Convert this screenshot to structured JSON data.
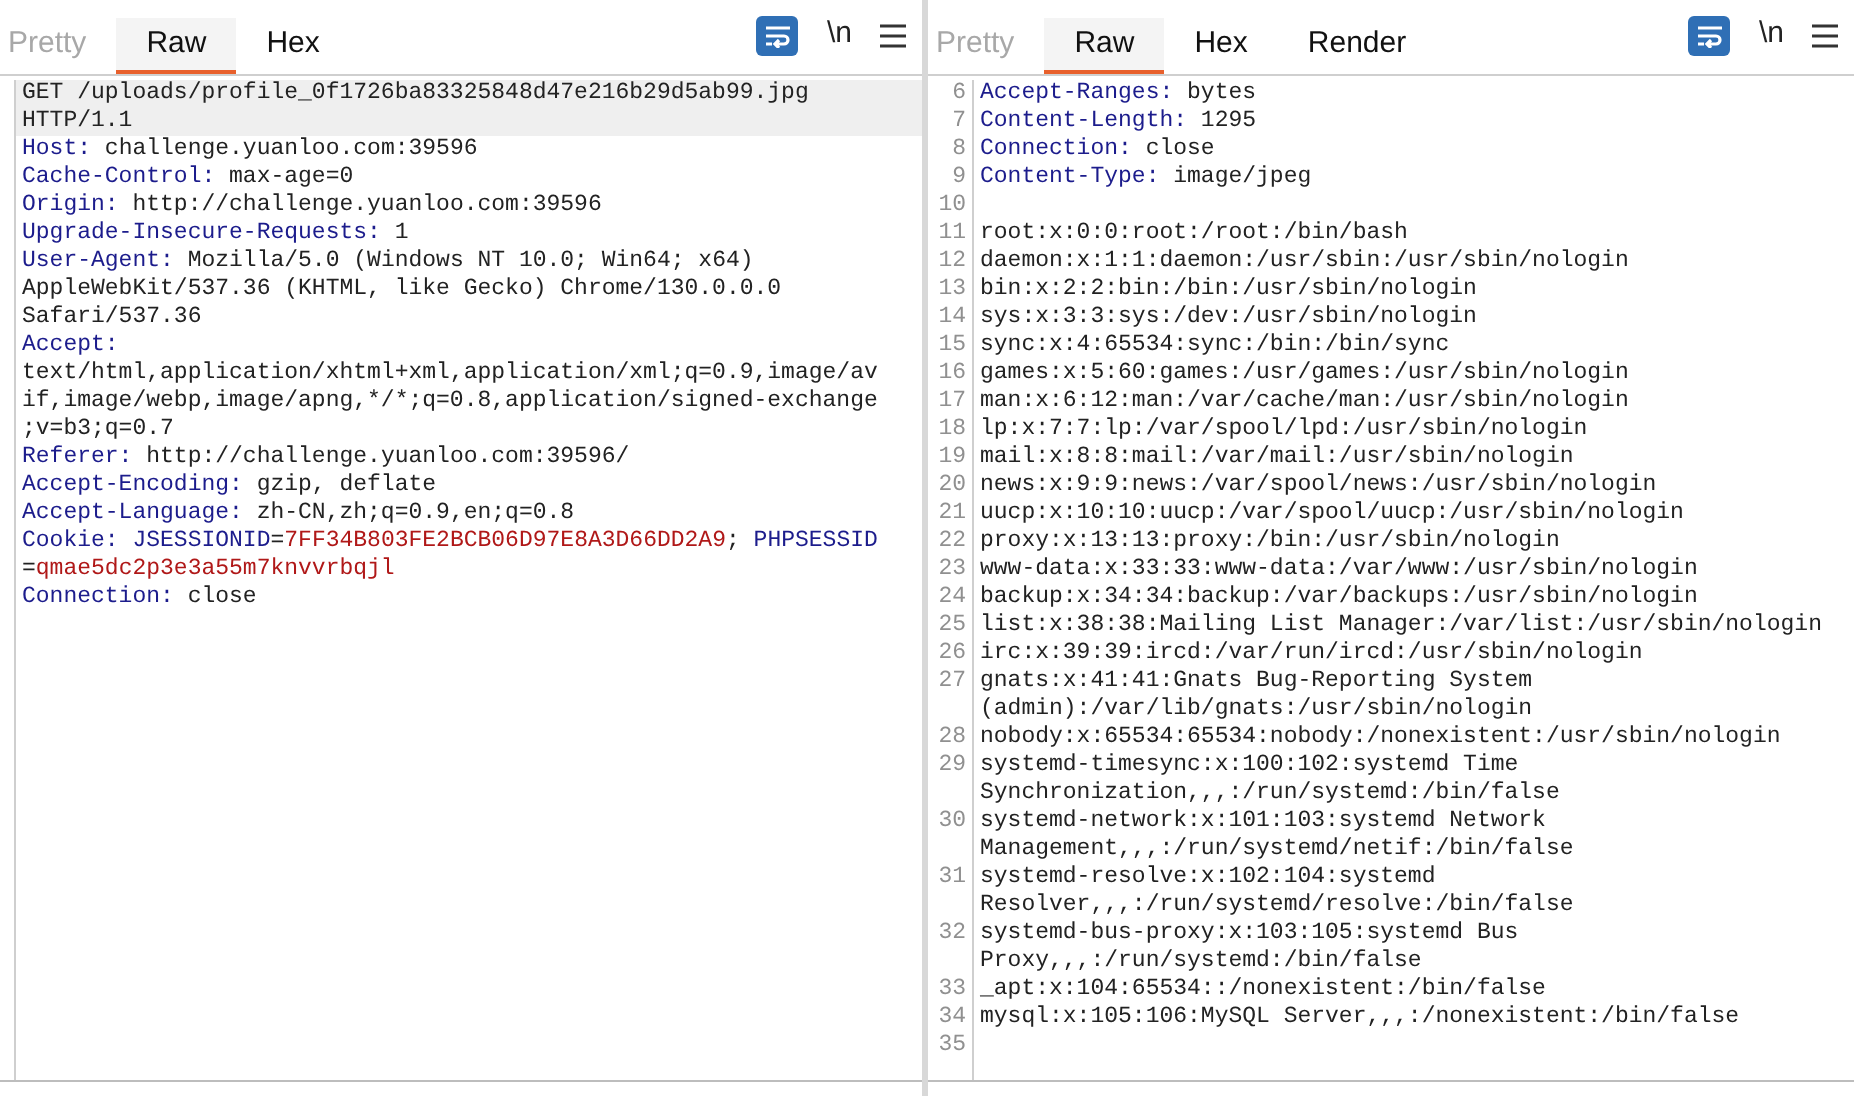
{
  "panels": [
    {
      "tabs": [
        {
          "label": "Pretty",
          "selected": false,
          "disabled": true
        },
        {
          "label": "Raw",
          "selected": true,
          "disabled": false
        },
        {
          "label": "Hex",
          "selected": false,
          "disabled": false
        }
      ],
      "toolbar": {
        "wrap_on": true,
        "newline_label": "\\n"
      },
      "lines": [
        {
          "rows": [
            [
              {
                "kind": "plain",
                "text": "GET /uploads/profile_0f1726ba83325848d47e216b29d5ab99.jpg"
              }
            ],
            [
              {
                "kind": "plain",
                "text": "HTTP/1.1"
              }
            ]
          ],
          "highlighted": true
        },
        {
          "rows": [
            [
              {
                "kind": "key",
                "text": "Host:"
              },
              {
                "kind": "plain",
                "text": " challenge.yuanloo.com:39596"
              }
            ]
          ],
          "highlighted": false
        },
        {
          "rows": [
            [
              {
                "kind": "key",
                "text": "Cache-Control:"
              },
              {
                "kind": "plain",
                "text": " max-age=0"
              }
            ]
          ],
          "highlighted": false
        },
        {
          "rows": [
            [
              {
                "kind": "key",
                "text": "Origin:"
              },
              {
                "kind": "plain",
                "text": " http://challenge.yuanloo.com:39596"
              }
            ]
          ],
          "highlighted": false
        },
        {
          "rows": [
            [
              {
                "kind": "key",
                "text": "Upgrade-Insecure-Requests:"
              },
              {
                "kind": "plain",
                "text": " 1"
              }
            ]
          ],
          "highlighted": false
        },
        {
          "rows": [
            [
              {
                "kind": "key",
                "text": "User-Agent:"
              },
              {
                "kind": "plain",
                "text": " Mozilla/5.0 (Windows NT 10.0; Win64; x64)"
              }
            ],
            [
              {
                "kind": "plain",
                "text": "AppleWebKit/537.36 (KHTML, like Gecko) Chrome/130.0.0.0"
              }
            ],
            [
              {
                "kind": "plain",
                "text": "Safari/537.36"
              }
            ]
          ],
          "highlighted": false
        },
        {
          "rows": [
            [
              {
                "kind": "key",
                "text": "Accept:"
              }
            ],
            [
              {
                "kind": "plain",
                "text": "text/html,application/xhtml+xml,application/xml;q=0.9,image/av"
              }
            ],
            [
              {
                "kind": "plain",
                "text": "if,image/webp,image/apng,*/*;q=0.8,application/signed-exchange"
              }
            ],
            [
              {
                "kind": "plain",
                "text": ";v=b3;q=0.7"
              }
            ]
          ],
          "highlighted": false
        },
        {
          "rows": [
            [
              {
                "kind": "key",
                "text": "Referer:"
              },
              {
                "kind": "plain",
                "text": " http://challenge.yuanloo.com:39596/"
              }
            ]
          ],
          "highlighted": false
        },
        {
          "rows": [
            [
              {
                "kind": "key",
                "text": "Accept-Encoding:"
              },
              {
                "kind": "plain",
                "text": " gzip, deflate"
              }
            ]
          ],
          "highlighted": false
        },
        {
          "rows": [
            [
              {
                "kind": "key",
                "text": "Accept-Language:"
              },
              {
                "kind": "plain",
                "text": " zh-CN,zh;q=0.9,en;q=0.8"
              }
            ]
          ],
          "highlighted": false
        },
        {
          "rows": [
            [
              {
                "kind": "key",
                "text": "Cookie:"
              },
              {
                "kind": "plain",
                "text": " "
              },
              {
                "kind": "key",
                "text": "JSESSIONID"
              },
              {
                "kind": "plain",
                "text": "="
              },
              {
                "kind": "value",
                "text": "7FF34B803FE2BCB06D97E8A3D66DD2A9"
              },
              {
                "kind": "plain",
                "text": "; "
              },
              {
                "kind": "key",
                "text": "PHPSESSID"
              }
            ],
            [
              {
                "kind": "plain",
                "text": "="
              },
              {
                "kind": "value",
                "text": "qmae5dc2p3e3a55m7knvvrbqjl"
              }
            ]
          ],
          "highlighted": false
        },
        {
          "rows": [
            [
              {
                "kind": "key",
                "text": "Connection:"
              },
              {
                "kind": "plain",
                "text": " close"
              }
            ]
          ],
          "highlighted": false
        }
      ]
    },
    {
      "tabs": [
        {
          "label": "Pretty",
          "selected": false,
          "disabled": true
        },
        {
          "label": "Raw",
          "selected": true,
          "disabled": false
        },
        {
          "label": "Hex",
          "selected": false,
          "disabled": false
        },
        {
          "label": "Render",
          "selected": false,
          "disabled": false
        }
      ],
      "toolbar": {
        "wrap_on": true,
        "newline_label": "\\n"
      },
      "lines": [
        {
          "number": "6",
          "rows": [
            [
              {
                "kind": "key",
                "text": "Accept-Ranges:"
              },
              {
                "kind": "plain",
                "text": " bytes"
              }
            ]
          ],
          "highlighted": false
        },
        {
          "number": "7",
          "rows": [
            [
              {
                "kind": "key",
                "text": "Content-Length:"
              },
              {
                "kind": "plain",
                "text": " 1295"
              }
            ]
          ],
          "highlighted": false
        },
        {
          "number": "8",
          "rows": [
            [
              {
                "kind": "key",
                "text": "Connection:"
              },
              {
                "kind": "plain",
                "text": " close"
              }
            ]
          ],
          "highlighted": false
        },
        {
          "number": "9",
          "rows": [
            [
              {
                "kind": "key",
                "text": "Content-Type:"
              },
              {
                "kind": "plain",
                "text": " image/jpeg"
              }
            ]
          ],
          "highlighted": false
        },
        {
          "number": "10",
          "highlighted": false
        },
        {
          "number": "11",
          "rows": [
            [
              {
                "kind": "plain",
                "text": "root:x:0:0:root:/root:/bin/bash"
              }
            ]
          ],
          "highlighted": false
        },
        {
          "number": "12",
          "rows": [
            [
              {
                "kind": "plain",
                "text": "daemon:x:1:1:daemon:/usr/sbin:/usr/sbin/nologin"
              }
            ]
          ],
          "highlighted": false
        },
        {
          "number": "13",
          "rows": [
            [
              {
                "kind": "plain",
                "text": "bin:x:2:2:bin:/bin:/usr/sbin/nologin"
              }
            ]
          ],
          "highlighted": false
        },
        {
          "number": "14",
          "rows": [
            [
              {
                "kind": "plain",
                "text": "sys:x:3:3:sys:/dev:/usr/sbin/nologin"
              }
            ]
          ],
          "highlighted": false
        },
        {
          "number": "15",
          "rows": [
            [
              {
                "kind": "plain",
                "text": "sync:x:4:65534:sync:/bin:/bin/sync"
              }
            ]
          ],
          "highlighted": false
        },
        {
          "number": "16",
          "rows": [
            [
              {
                "kind": "plain",
                "text": "games:x:5:60:games:/usr/games:/usr/sbin/nologin"
              }
            ]
          ],
          "highlighted": false
        },
        {
          "number": "17",
          "rows": [
            [
              {
                "kind": "plain",
                "text": "man:x:6:12:man:/var/cache/man:/usr/sbin/nologin"
              }
            ]
          ],
          "highlighted": false
        },
        {
          "number": "18",
          "rows": [
            [
              {
                "kind": "plain",
                "text": "lp:x:7:7:lp:/var/spool/lpd:/usr/sbin/nologin"
              }
            ]
          ],
          "highlighted": false
        },
        {
          "number": "19",
          "rows": [
            [
              {
                "kind": "plain",
                "text": "mail:x:8:8:mail:/var/mail:/usr/sbin/nologin"
              }
            ]
          ],
          "highlighted": false
        },
        {
          "number": "20",
          "rows": [
            [
              {
                "kind": "plain",
                "text": "news:x:9:9:news:/var/spool/news:/usr/sbin/nologin"
              }
            ]
          ],
          "highlighted": false
        },
        {
          "number": "21",
          "rows": [
            [
              {
                "kind": "plain",
                "text": "uucp:x:10:10:uucp:/var/spool/uucp:/usr/sbin/nologin"
              }
            ]
          ],
          "highlighted": false
        },
        {
          "number": "22",
          "rows": [
            [
              {
                "kind": "plain",
                "text": "proxy:x:13:13:proxy:/bin:/usr/sbin/nologin"
              }
            ]
          ],
          "highlighted": false
        },
        {
          "number": "23",
          "rows": [
            [
              {
                "kind": "plain",
                "text": "www-data:x:33:33:www-data:/var/www:/usr/sbin/nologin"
              }
            ]
          ],
          "highlighted": false
        },
        {
          "number": "24",
          "rows": [
            [
              {
                "kind": "plain",
                "text": "backup:x:34:34:backup:/var/backups:/usr/sbin/nologin"
              }
            ]
          ],
          "highlighted": false
        },
        {
          "number": "25",
          "rows": [
            [
              {
                "kind": "plain",
                "text": "list:x:38:38:Mailing List Manager:/var/list:/usr/sbin/nologin"
              }
            ]
          ],
          "highlighted": false
        },
        {
          "number": "26",
          "rows": [
            [
              {
                "kind": "plain",
                "text": "irc:x:39:39:ircd:/var/run/ircd:/usr/sbin/nologin"
              }
            ]
          ],
          "highlighted": false
        },
        {
          "number": "27",
          "rows": [
            [
              {
                "kind": "plain",
                "text": "gnats:x:41:41:Gnats Bug-Reporting System"
              }
            ],
            [
              {
                "kind": "plain",
                "text": "(admin):/var/lib/gnats:/usr/sbin/nologin"
              }
            ]
          ],
          "highlighted": false
        },
        {
          "number": "28",
          "rows": [
            [
              {
                "kind": "plain",
                "text": "nobody:x:65534:65534:nobody:/nonexistent:/usr/sbin/nologin"
              }
            ]
          ],
          "highlighted": false
        },
        {
          "number": "29",
          "rows": [
            [
              {
                "kind": "plain",
                "text": "systemd-timesync:x:100:102:systemd Time"
              }
            ],
            [
              {
                "kind": "plain",
                "text": "Synchronization,,,:/run/systemd:/bin/false"
              }
            ]
          ],
          "highlighted": false
        },
        {
          "number": "30",
          "rows": [
            [
              {
                "kind": "plain",
                "text": "systemd-network:x:101:103:systemd Network"
              }
            ],
            [
              {
                "kind": "plain",
                "text": "Management,,,:/run/systemd/netif:/bin/false"
              }
            ]
          ],
          "highlighted": false
        },
        {
          "number": "31",
          "rows": [
            [
              {
                "kind": "plain",
                "text": "systemd-resolve:x:102:104:systemd"
              }
            ],
            [
              {
                "kind": "plain",
                "text": "Resolver,,,:/run/systemd/resolve:/bin/false"
              }
            ]
          ],
          "highlighted": false
        },
        {
          "number": "32",
          "rows": [
            [
              {
                "kind": "plain",
                "text": "systemd-bus-proxy:x:103:105:systemd Bus"
              }
            ],
            [
              {
                "kind": "plain",
                "text": "Proxy,,,:/run/systemd:/bin/false"
              }
            ]
          ],
          "highlighted": false
        },
        {
          "number": "33",
          "rows": [
            [
              {
                "kind": "plain",
                "text": "_apt:x:104:65534::/nonexistent:/bin/false"
              }
            ]
          ],
          "highlighted": false
        },
        {
          "number": "34",
          "rows": [
            [
              {
                "kind": "plain",
                "text": "mysql:x:105:106:MySQL Server,,,:/nonexistent:/bin/false"
              }
            ]
          ],
          "highlighted": false
        },
        {
          "number": "35",
          "highlighted": false
        }
      ]
    }
  ]
}
